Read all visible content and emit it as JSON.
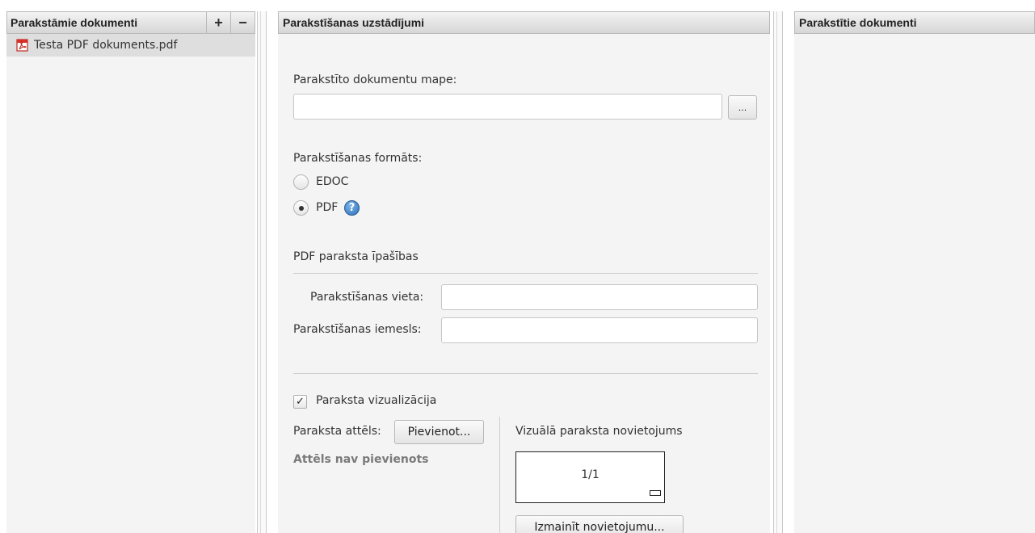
{
  "left_panel": {
    "title": "Parakstāmie dokumenti",
    "add_label": "+",
    "remove_label": "−",
    "documents": [
      {
        "name": "Testa PDF dokuments.pdf",
        "icon": "pdf-file-icon"
      }
    ]
  },
  "middle_panel": {
    "title": "Parakstīšanas uzstādījumi",
    "folder_label": "Parakstīto dokumentu mape:",
    "folder_value": "",
    "browse_label": "...",
    "format_label": "Parakstīšanas formāts:",
    "format_options": [
      {
        "label": "EDOC",
        "selected": false
      },
      {
        "label": "PDF",
        "selected": true
      }
    ],
    "help_icon": "?",
    "pdf_section_title": "PDF paraksta īpašības",
    "location_label": "Parakstīšanas vieta:",
    "location_value": "",
    "reason_label": "Parakstīšanas iemesls:",
    "reason_value": "",
    "visualization_label": "Paraksta vizualizācija",
    "visualization_checked": true,
    "checkmark": "✓",
    "image_label": "Paraksta attēls:",
    "add_image_label": "Pievienot...",
    "no_image_text": "Attēls nav pievienots",
    "placement_title": "Vizuālā paraksta novietojums",
    "page_indicator": "1/1",
    "change_placement_label": "Izmainīt novietojumu..."
  },
  "right_panel": {
    "title": "Parakstītie dokumenti"
  },
  "colors": {
    "panel_bg": "#f4f4f4",
    "selected_row": "#dedede",
    "muted_text": "#7a7a7a",
    "help_blue": "#2b6fb8"
  }
}
